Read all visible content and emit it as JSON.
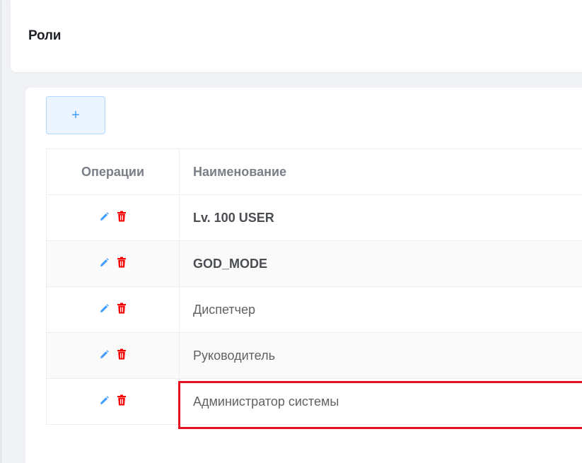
{
  "page": {
    "title": "Роли"
  },
  "toolbar": {
    "add_label": "+"
  },
  "table": {
    "columns": {
      "operations": "Операции",
      "name": "Наименование"
    },
    "rows": [
      {
        "name": "Lv. 100 USER",
        "bold": true
      },
      {
        "name": "GOD_MODE",
        "bold": true
      },
      {
        "name": "Диспетчер",
        "bold": false
      },
      {
        "name": "Руководитель",
        "bold": false
      },
      {
        "name": "Администратор системы",
        "bold": false,
        "highlighted": true
      }
    ]
  },
  "icons": {
    "edit": "pencil-icon",
    "delete": "trash-icon"
  },
  "colors": {
    "accent": "#409eff",
    "delete": "#f50000",
    "highlight": "#e81123"
  }
}
